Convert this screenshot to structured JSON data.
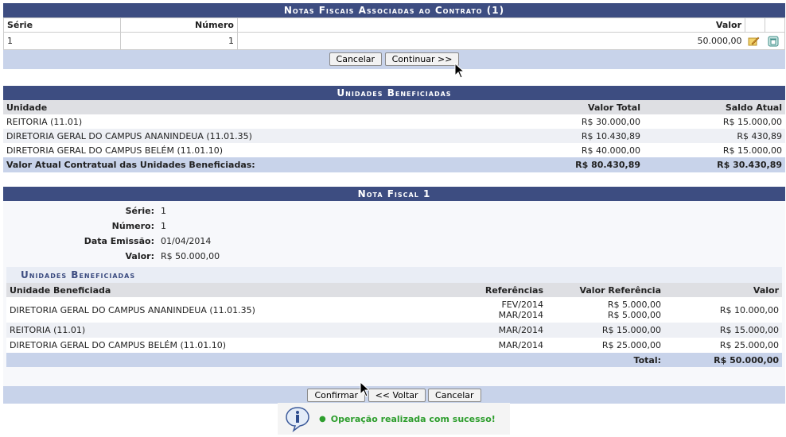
{
  "notas_panel": {
    "title": "Notas Fiscais Associadas ao Contrato (1)",
    "headers": {
      "serie": "Série",
      "numero": "Número",
      "valor": "Valor"
    },
    "rows": [
      {
        "serie": "1",
        "numero": "1",
        "valor": "50.000,00"
      }
    ],
    "edit_icon": "edit-pencil-icon",
    "delete_icon": "trash-icon",
    "cancel_label": "Cancelar",
    "continue_label": "Continuar >>"
  },
  "unidades_panel": {
    "title": "Unidades Beneficiadas",
    "headers": {
      "unidade": "Unidade",
      "valor_total": "Valor Total",
      "saldo_atual": "Saldo Atual"
    },
    "rows": [
      {
        "unidade": "REITORIA (11.01)",
        "valor_total": "R$ 30.000,00",
        "saldo_atual": "R$ 15.000,00"
      },
      {
        "unidade": "DIRETORIA GERAL DO CAMPUS ANANINDEUA (11.01.35)",
        "valor_total": "R$ 10.430,89",
        "saldo_atual": "R$ 430,89"
      },
      {
        "unidade": "DIRETORIA GERAL DO CAMPUS BELÉM (11.01.10)",
        "valor_total": "R$ 40.000,00",
        "saldo_atual": "R$ 15.000,00"
      }
    ],
    "total_label": "Valor Atual Contratual das Unidades Beneficiadas:",
    "total_valor": "R$ 80.430,89",
    "total_saldo": "R$ 30.430,89"
  },
  "nota_panel": {
    "title": "Nota Fiscal 1",
    "fields": {
      "serie_label": "Série:",
      "serie_value": "1",
      "numero_label": "Número:",
      "numero_value": "1",
      "data_label": "Data Emissão:",
      "data_value": "01/04/2014",
      "valor_label": "Valor:",
      "valor_value": "R$ 50.000,00"
    },
    "sub_title": "Unidades Beneficiadas",
    "headers": {
      "unidade": "Unidade Beneficiada",
      "referencias": "Referências",
      "valor_ref": "Valor Referência",
      "valor": "Valor"
    },
    "rows": [
      {
        "unidade": "DIRETORIA GERAL DO CAMPUS ANANINDEUA (11.01.35)",
        "ref1": "FEV/2014",
        "ref2": "MAR/2014",
        "vref1": "R$ 5.000,00",
        "vref2": "R$ 5.000,00",
        "valor": "R$ 10.000,00"
      },
      {
        "unidade": "REITORIA (11.01)",
        "ref1": "MAR/2014",
        "vref1": "R$ 15.000,00",
        "valor": "R$ 15.000,00"
      },
      {
        "unidade": "DIRETORIA GERAL DO CAMPUS BELÉM (11.01.10)",
        "ref1": "MAR/2014",
        "vref1": "R$ 25.000,00",
        "valor": "R$ 25.000,00"
      }
    ],
    "total_label": "Total:",
    "total_value": "R$ 50.000,00",
    "confirm_label": "Confirmar",
    "back_label": "<< Voltar",
    "cancel_label": "Cancelar"
  },
  "message": {
    "icon": "info-icon",
    "text": "Operação realizada com sucesso!",
    "color": "#2e9e2e"
  },
  "colors": {
    "header_bg": "#3d4d81",
    "footer_bg": "#c8d3ea",
    "row_hdr_bg": "#dedfe3"
  }
}
